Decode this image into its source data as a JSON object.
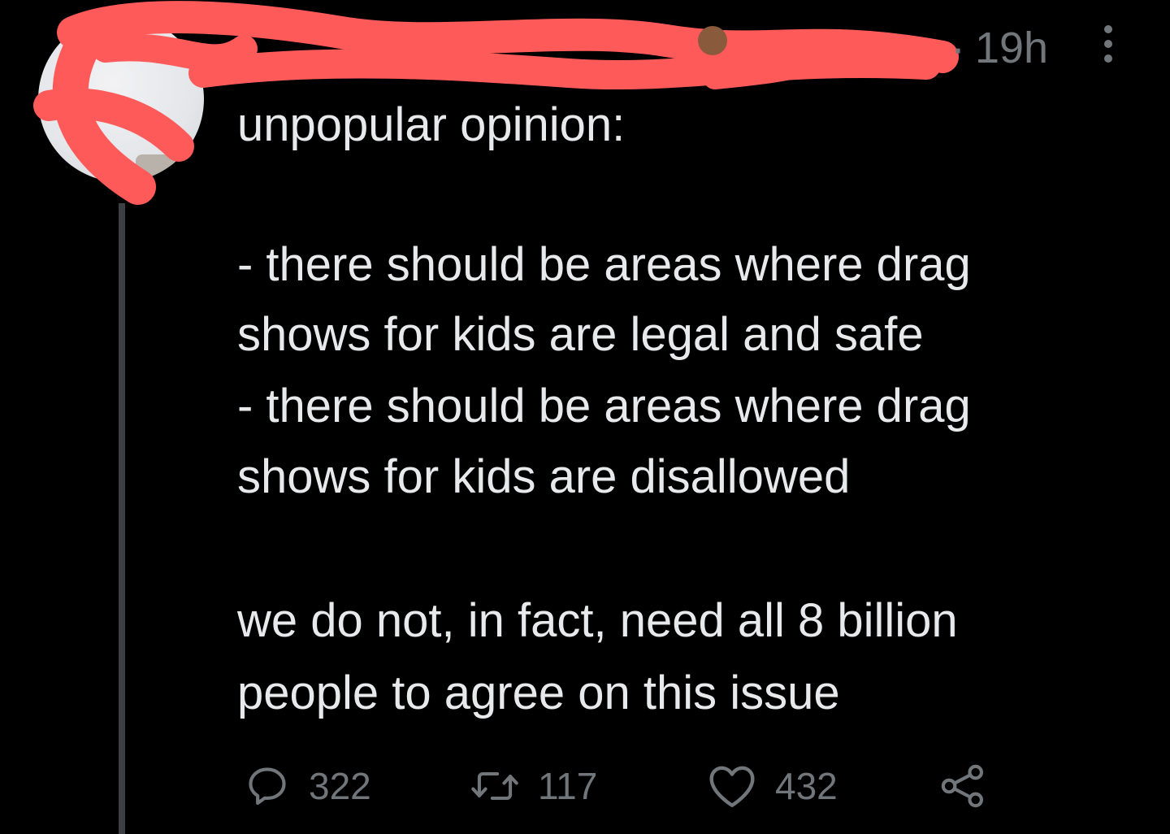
{
  "tweet": {
    "time_separator": "·",
    "timestamp": "19h",
    "lines": [
      "unpopular opinion:",
      "- there should be areas where drag",
      "shows for kids are legal and safe",
      "- there should be areas where drag",
      "shows for kids are disallowed",
      "we do not, in fact, need all 8 billion",
      "people to agree on this issue"
    ]
  },
  "actions": {
    "replies": "322",
    "retweets": "117",
    "likes": "432"
  },
  "icons": {
    "reply": "reply-icon",
    "retweet": "retweet-icon",
    "like": "heart-icon",
    "share": "share-icon",
    "more": "more-vertical-icon"
  },
  "colors": {
    "background": "#000000",
    "text": "#e7e9ea",
    "secondary": "#71767b",
    "redaction": "#ff5a5a"
  }
}
